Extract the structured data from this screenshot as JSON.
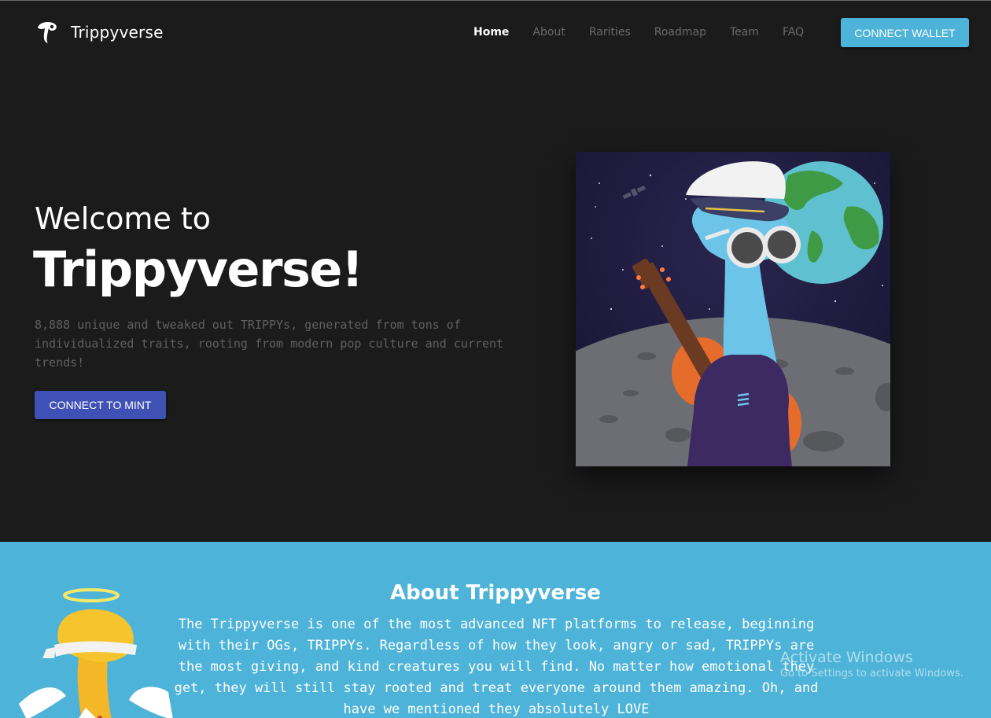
{
  "brand": {
    "name": "Trippyverse",
    "logo_icon": "trippy-logo-icon"
  },
  "nav": {
    "items": [
      {
        "label": "Home",
        "active": true
      },
      {
        "label": "About",
        "active": false
      },
      {
        "label": "Rarities",
        "active": false
      },
      {
        "label": "Roadmap",
        "active": false
      },
      {
        "label": "Team",
        "active": false
      },
      {
        "label": "FAQ",
        "active": false
      }
    ],
    "connect_wallet_label": "CONNECT WALLET"
  },
  "hero": {
    "welcome": "Welcome to",
    "title": "Trippyverse!",
    "description": "8,888 unique and tweaked out TRIPPYs, generated from tons of individualized traits, rooting from modern pop culture and current trends!",
    "mint_label": "CONNECT TO MINT",
    "artwork": "trippy-nft-artwork"
  },
  "about": {
    "title": "About Trippyverse",
    "text": "The Trippyverse is one of the most advanced NFT platforms to release, beginning with their OGs, TRIPPYs. Regardless of how they look, angry or sad, TRIPPYs are the most giving, and kind creatures you will find. No matter how emotional they get, they will still stay rooted and treat everyone around them amazing. Oh, and have we mentioned they absolutely LOVE",
    "mascot": "angel-trippy-mascot"
  },
  "watermark": {
    "line1": "Activate Windows",
    "line2": "Go to Settings to activate Windows."
  },
  "colors": {
    "background": "#1b1b1b",
    "accent": "#4eb3d8",
    "mint_button": "#3f51b5",
    "muted_text": "#606060"
  }
}
